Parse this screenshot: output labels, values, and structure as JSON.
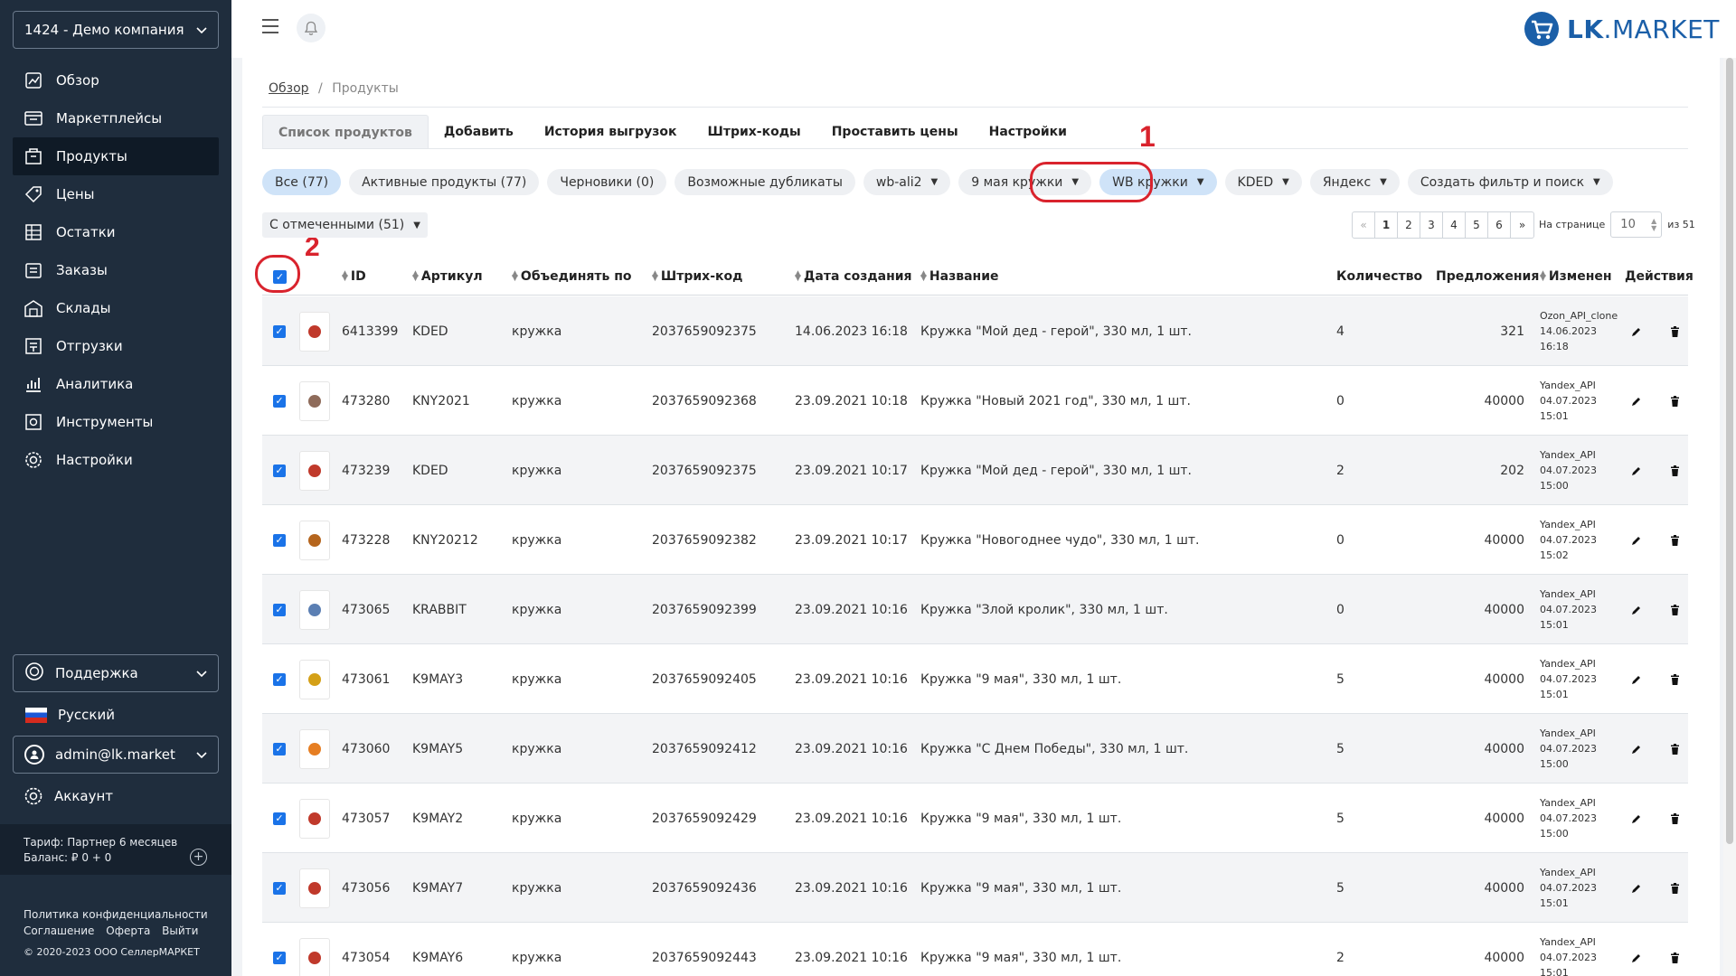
{
  "sidebar": {
    "company": "1424 - Демо компания",
    "nav": [
      {
        "label": "Обзор",
        "icon": "dashboard-icon"
      },
      {
        "label": "Маркетплейсы",
        "icon": "marketplace-icon"
      },
      {
        "label": "Продукты",
        "icon": "products-icon",
        "active": true
      },
      {
        "label": "Цены",
        "icon": "price-tag-icon"
      },
      {
        "label": "Остатки",
        "icon": "stock-icon"
      },
      {
        "label": "Заказы",
        "icon": "orders-icon"
      },
      {
        "label": "Склады",
        "icon": "warehouse-icon"
      },
      {
        "label": "Отгрузки",
        "icon": "shipments-icon"
      },
      {
        "label": "Аналитика",
        "icon": "analytics-icon"
      },
      {
        "label": "Инструменты",
        "icon": "tools-icon"
      },
      {
        "label": "Настройки",
        "icon": "settings-icon"
      }
    ],
    "support": "Поддержка",
    "language": "Русский",
    "user": "admin@lk.market",
    "account": "Аккаунт",
    "tariff": "Тариф: Партнер 6 месяцев",
    "balance": "Баланс: ₽ 0 + 0",
    "links": {
      "privacy": "Политика конфиденциальности",
      "agreement": "Соглашение",
      "offer": "Оферта",
      "logout": "Выйти"
    },
    "copyright": "© 2020-2023 ООО СеллерМАРКЕТ"
  },
  "header": {
    "logo_bold": "LK",
    "logo_rest": ".MARKET"
  },
  "breadcrumb": {
    "root": "Обзор",
    "sep": "/",
    "current": "Продукты"
  },
  "tabs": [
    "Список продуктов",
    "Добавить",
    "История выгрузок",
    "Штрих-коды",
    "Проставить цены",
    "Настройки"
  ],
  "filters": [
    {
      "label": "Все (77)",
      "active": true,
      "caret": false
    },
    {
      "label": "Активные продукты (77)",
      "caret": false
    },
    {
      "label": "Черновики (0)",
      "caret": false
    },
    {
      "label": "Возможные дубликаты",
      "caret": false
    },
    {
      "label": "wb-ali2",
      "caret": true
    },
    {
      "label": "9 мая кружки",
      "caret": true
    },
    {
      "label": "WB кружки",
      "caret": true,
      "active": true,
      "highlighted": true
    },
    {
      "label": "KDED",
      "caret": true
    },
    {
      "label": "Яндекс",
      "caret": true
    },
    {
      "label": "Создать фильтр и поиск",
      "caret": true
    }
  ],
  "annotations": {
    "one": "1",
    "two": "2"
  },
  "bulk_action": "С отмеченными (51)",
  "pagination": {
    "prev": "«",
    "pages": [
      "1",
      "2",
      "3",
      "4",
      "5",
      "6"
    ],
    "next": "»",
    "current": "1"
  },
  "per_page": {
    "label": "На странице",
    "value": "10",
    "of": "из 51"
  },
  "columns": {
    "id": "ID",
    "sku": "Артикул",
    "group": "Объединять по",
    "barcode": "Штрих-код",
    "created": "Дата создания",
    "name": "Название",
    "qty": "Количество",
    "offers": "Предложения",
    "changed": "Изменен",
    "actions": "Действия"
  },
  "rows": [
    {
      "id": "6413399",
      "sku": "KDED",
      "group": "кружка",
      "barcode": "2037659092375",
      "created": "14.06.2023 16:18",
      "name": "Кружка \"Мой дед - герой\", 330 мл, 1 шт.",
      "qty": "4",
      "offers": "321",
      "changed_by": "Ozon_API_clone",
      "changed_date": "14.06.2023",
      "changed_time": "16:18",
      "thumb_color": "#c0392b"
    },
    {
      "id": "473280",
      "sku": "KNY2021",
      "group": "кружка",
      "barcode": "2037659092368",
      "created": "23.09.2021 10:18",
      "name": "Кружка \"Новый 2021 год\", 330 мл, 1 шт.",
      "qty": "0",
      "offers": "40000",
      "changed_by": "Yandex_API",
      "changed_date": "04.07.2023",
      "changed_time": "15:01",
      "thumb_color": "#8e6b5a"
    },
    {
      "id": "473239",
      "sku": "KDED",
      "group": "кружка",
      "barcode": "2037659092375",
      "created": "23.09.2021 10:17",
      "name": "Кружка \"Мой дед - герой\", 330 мл, 1 шт.",
      "qty": "2",
      "offers": "202",
      "changed_by": "Yandex_API",
      "changed_date": "04.07.2023",
      "changed_time": "15:00",
      "thumb_color": "#c0392b"
    },
    {
      "id": "473228",
      "sku": "KNY20212",
      "group": "кружка",
      "barcode": "2037659092382",
      "created": "23.09.2021 10:17",
      "name": "Кружка \"Новогоднее чудо\", 330 мл, 1 шт.",
      "qty": "0",
      "offers": "40000",
      "changed_by": "Yandex_API",
      "changed_date": "04.07.2023",
      "changed_time": "15:02",
      "thumb_color": "#b5651d"
    },
    {
      "id": "473065",
      "sku": "KRABBIT",
      "group": "кружка",
      "barcode": "2037659092399",
      "created": "23.09.2021 10:16",
      "name": "Кружка \"Злой кролик\", 330 мл, 1 шт.",
      "qty": "0",
      "offers": "40000",
      "changed_by": "Yandex_API",
      "changed_date": "04.07.2023",
      "changed_time": "15:01",
      "thumb_color": "#5b7fb3"
    },
    {
      "id": "473061",
      "sku": "K9MAY3",
      "group": "кружка",
      "barcode": "2037659092405",
      "created": "23.09.2021 10:16",
      "name": "Кружка \"9 мая\", 330 мл, 1 шт.",
      "qty": "5",
      "offers": "40000",
      "changed_by": "Yandex_API",
      "changed_date": "04.07.2023",
      "changed_time": "15:01",
      "thumb_color": "#d4a017"
    },
    {
      "id": "473060",
      "sku": "K9MAY5",
      "group": "кружка",
      "barcode": "2037659092412",
      "created": "23.09.2021 10:16",
      "name": "Кружка \"С Днем Победы\", 330 мл, 1 шт.",
      "qty": "5",
      "offers": "40000",
      "changed_by": "Yandex_API",
      "changed_date": "04.07.2023",
      "changed_time": "15:00",
      "thumb_color": "#e67e22"
    },
    {
      "id": "473057",
      "sku": "K9MAY2",
      "group": "кружка",
      "barcode": "2037659092429",
      "created": "23.09.2021 10:16",
      "name": "Кружка \"9 мая\", 330 мл, 1 шт.",
      "qty": "5",
      "offers": "40000",
      "changed_by": "Yandex_API",
      "changed_date": "04.07.2023",
      "changed_time": "15:00",
      "thumb_color": "#c0392b"
    },
    {
      "id": "473056",
      "sku": "K9MAY7",
      "group": "кружка",
      "barcode": "2037659092436",
      "created": "23.09.2021 10:16",
      "name": "Кружка \"9 мая\", 330 мл, 1 шт.",
      "qty": "5",
      "offers": "40000",
      "changed_by": "Yandex_API",
      "changed_date": "04.07.2023",
      "changed_time": "15:01",
      "thumb_color": "#c0392b"
    },
    {
      "id": "473054",
      "sku": "K9MAY6",
      "group": "кружка",
      "barcode": "2037659092443",
      "created": "23.09.2021 10:16",
      "name": "Кружка \"9 мая\", 330 мл, 1 шт.",
      "qty": "2",
      "offers": "40000",
      "changed_by": "Yandex_API",
      "changed_date": "04.07.2023",
      "changed_time": "15:01",
      "thumb_color": "#c0392b"
    }
  ],
  "colors": {
    "sidebar": "#1f2d3d",
    "accent": "#1a73e8",
    "annotation": "#d9232d",
    "logo": "#1b5fa8"
  }
}
